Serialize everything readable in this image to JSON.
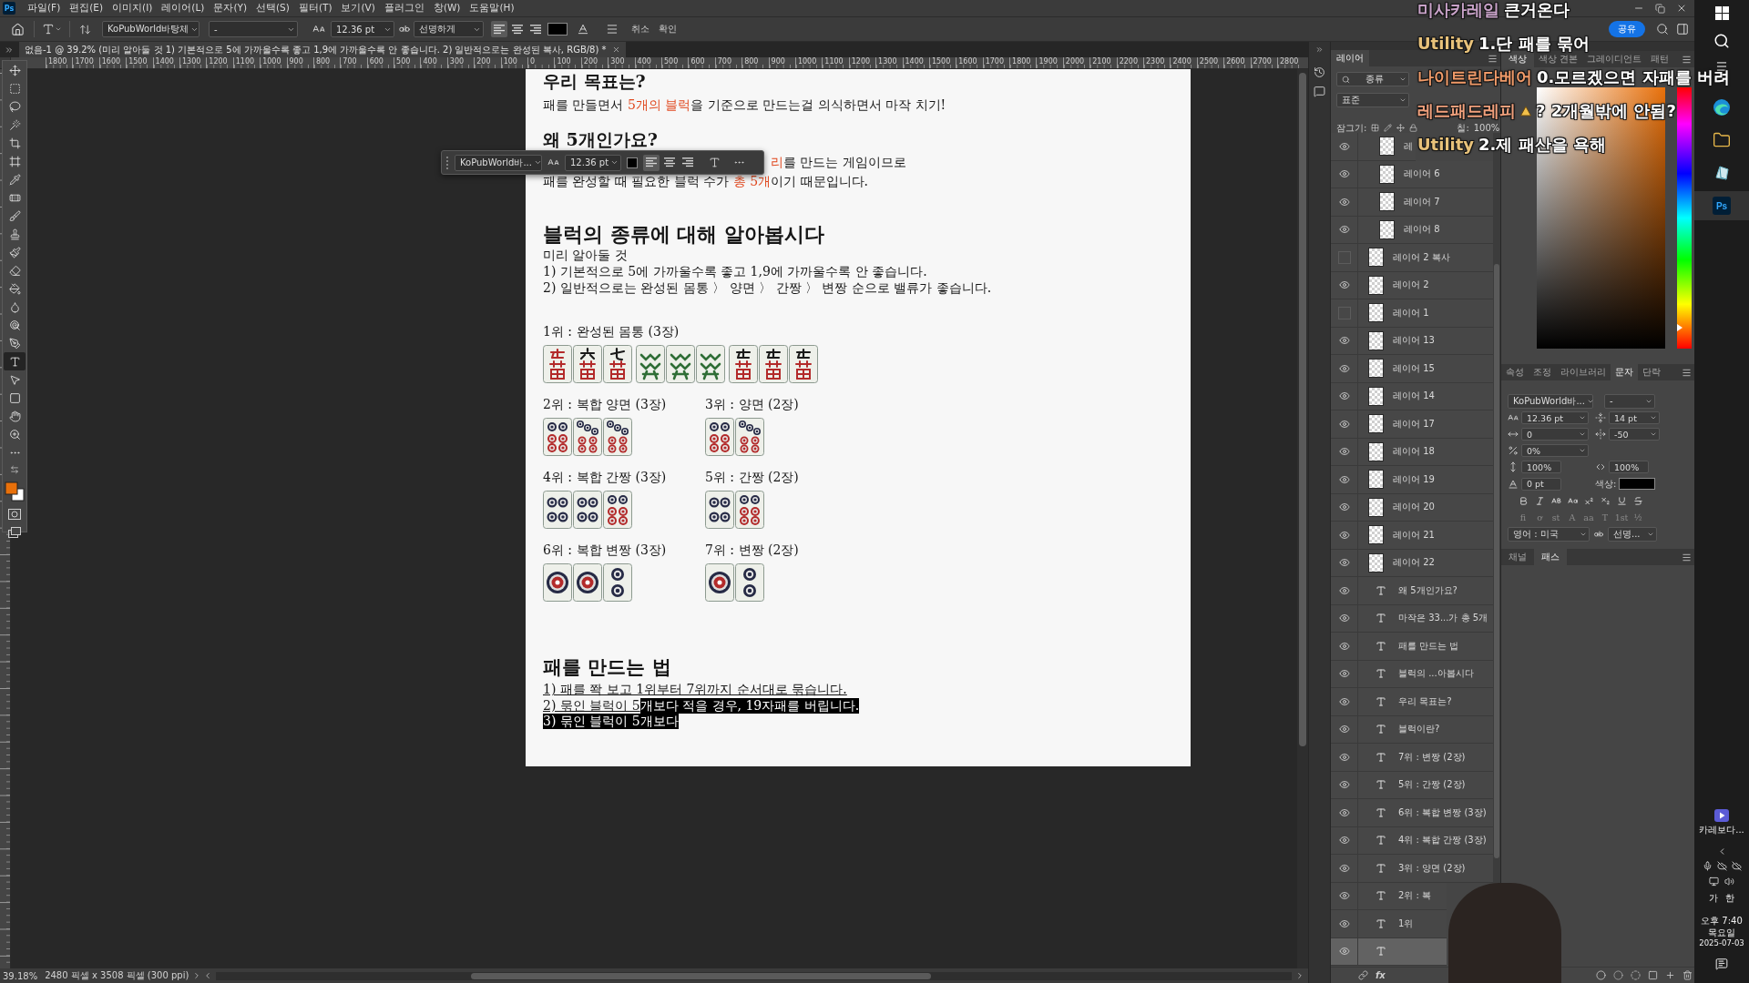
{
  "menu_bar": {
    "logo": "Ps",
    "items": [
      "파일(F)",
      "편집(E)",
      "이미지(I)",
      "레이어(L)",
      "문자(Y)",
      "선택(S)",
      "필터(T)",
      "보기(V)",
      "플러그인",
      "창(W)",
      "도움말(H)"
    ]
  },
  "options_bar": {
    "font": "KoPubWorld바탕체",
    "style": "-",
    "size": "12.36 pt",
    "antialias": "선명하게",
    "align": [
      {
        "kind": "left",
        "selected": true
      },
      {
        "kind": "center",
        "selected": false
      },
      {
        "kind": "right",
        "selected": false
      }
    ],
    "cancel": "취소",
    "commit": "확인",
    "share": "공유"
  },
  "document_tab": {
    "title": "없음-1 @ 39.2% (미리 알아둘 것  1) 기본적으로 5에 가까울수록 좋고 1,9에 가까울수록 안 좋습니다. 2) 일반적으로는 완성된 복사, RGB/8) *"
  },
  "ruler": {
    "labels": [
      "1800",
      "1700",
      "1600",
      "1500",
      "1400",
      "1300",
      "1200",
      "1100",
      "1000",
      "900",
      "800",
      "700",
      "600",
      "500",
      "400",
      "300",
      "200",
      "100",
      "0",
      "100",
      "200",
      "300",
      "400",
      "500",
      "600",
      "700",
      "800",
      "900",
      "1000",
      "1100",
      "1200",
      "1300",
      "1400",
      "1500",
      "1600",
      "1700",
      "1800",
      "1900",
      "2000",
      "2100",
      "2200",
      "2300",
      "2400",
      "2500",
      "2600",
      "2700",
      "2800"
    ]
  },
  "tools": [
    {
      "kind": "move",
      "selected": false
    },
    {
      "kind": "marquee",
      "selected": false
    },
    {
      "kind": "lasso",
      "selected": false
    },
    {
      "kind": "object-select",
      "selected": false
    },
    {
      "kind": "crop",
      "selected": false
    },
    {
      "kind": "frame",
      "selected": false
    },
    {
      "kind": "eyedropper",
      "selected": false
    },
    {
      "kind": "healing",
      "selected": false
    },
    {
      "kind": "brush",
      "selected": false
    },
    {
      "kind": "stamp",
      "selected": false
    },
    {
      "kind": "history-brush",
      "selected": false
    },
    {
      "kind": "eraser",
      "selected": false
    },
    {
      "kind": "bucket",
      "selected": false
    },
    {
      "kind": "blur",
      "selected": false
    },
    {
      "kind": "dodge",
      "selected": false
    },
    {
      "kind": "pen",
      "selected": false
    },
    {
      "kind": "type",
      "selected": true
    },
    {
      "kind": "path-select",
      "selected": false
    },
    {
      "kind": "rectangle",
      "selected": false
    },
    {
      "kind": "hand",
      "selected": false
    },
    {
      "kind": "zoom",
      "selected": false
    },
    {
      "kind": "more",
      "selected": false
    }
  ],
  "context_bar": {
    "font": "KoPubWorld바...",
    "size": "12.36 pt",
    "align": [
      {
        "kind": "left",
        "selected": true
      },
      {
        "kind": "center",
        "selected": false
      },
      {
        "kind": "right",
        "selected": false
      }
    ]
  },
  "document": {
    "goal": {
      "heading": "우리 목표는?",
      "text": "패를 만들면서 **5개의 블럭**을 기준으로 만드는걸 의식하면서 마작 치기!"
    },
    "why": {
      "heading": "왜 5개인가요?",
      "lines": [
        "**리**를 만드는 게임이므로",
        "패를 완성할 때 필요한 블럭 수가 **총 5개**이기 때문입니다."
      ]
    },
    "kinds": {
      "heading": "블럭의 종류에 대해 알아봅시다",
      "notes": [
        "미리 알아둘 것",
        "1) 기본적으로 5에 가까울수록 좋고 1,9에 가까울수록 안 좋습니다.",
        "2) 일반적으로는 완성된 몸통 〉 양면 〉 간짱 〉 변짱 순으로 밸류가 좋습니다."
      ],
      "ranks": [
        {
          "label": "1위 : 완성된 몸통 (3장)",
          "groups": [
            [
              {
                "kind": "man5-red"
              },
              {
                "kind": "man6"
              },
              {
                "kind": "man7"
              }
            ],
            [
              {
                "kind": "dragon"
              },
              {
                "kind": "dragon"
              },
              {
                "kind": "dragon"
              }
            ],
            [
              {
                "kind": "man5"
              },
              {
                "kind": "man5"
              },
              {
                "kind": "man5"
              }
            ]
          ]
        },
        {
          "label": "2위 : 복합 양면 (3장)",
          "groups": [
            [
              {
                "kind": "pin6"
              },
              {
                "kind": "pin7"
              },
              {
                "kind": "pin7"
              }
            ]
          ]
        },
        {
          "label": "3위 : 양면 (2장)",
          "groups": [
            [
              {
                "kind": "pin6"
              },
              {
                "kind": "pin7"
              }
            ]
          ]
        },
        {
          "label": "4위 : 복합 간짱 (3장)",
          "groups": [
            [
              {
                "kind": "pin4"
              },
              {
                "kind": "pin4"
              },
              {
                "kind": "pin6"
              }
            ]
          ]
        },
        {
          "label": "5위 : 간짱 (2장)",
          "groups": [
            [
              {
                "kind": "pin4"
              },
              {
                "kind": "pin6"
              }
            ]
          ]
        },
        {
          "label": "6위 : 복합 변짱 (3장)",
          "groups": [
            [
              {
                "kind": "pin1"
              },
              {
                "kind": "pin1"
              },
              {
                "kind": "pin2"
              }
            ]
          ]
        },
        {
          "label": "7위 : 변짱 (2장)",
          "groups": [
            [
              {
                "kind": "pin1"
              },
              {
                "kind": "pin2"
              }
            ]
          ]
        }
      ]
    },
    "method": {
      "heading": "패를 만드는 법",
      "lines": [
        [
          {
            "text": "1) 패를 쫙 보고 1위부터 7위까지 순서대로 묶습니다.",
            "selected": false
          }
        ],
        [
          {
            "text": "2) 묶인 블럭이 5",
            "selected": false
          },
          {
            "text": "개보다 적을 경우, 19자패를 버립니다.",
            "selected": true
          }
        ],
        [
          {
            "text": "3) 묶인 블럭이 5개보다",
            "selected": true
          }
        ]
      ]
    }
  },
  "status_bar": {
    "zoom": "39.18%",
    "info": "2480 픽셀 x 3508 픽셀 (300 ppi)"
  },
  "layers_panel": {
    "tab": "레이어",
    "search": "종류",
    "blend_mode": "표준",
    "lock_label": "잠그기:",
    "fill_label": "칠:",
    "fill_value": "100%",
    "footer_label": "fx",
    "layers": [
      {
        "kind": "group",
        "children": [
          {
            "kind": "raster",
            "name": "레",
            "visible": true,
            "selected": false
          },
          {
            "kind": "raster",
            "name": "레이어 6",
            "visible": true,
            "selected": false
          },
          {
            "kind": "raster",
            "name": "레이어 7",
            "visible": true,
            "selected": false
          },
          {
            "kind": "raster",
            "name": "레이어 8",
            "visible": true,
            "selected": false
          }
        ]
      },
      {
        "kind": "raster",
        "name": "레이어 2 복사",
        "visible": false,
        "selected": false
      },
      {
        "kind": "raster",
        "name": "레이어 2",
        "visible": true,
        "selected": false
      },
      {
        "kind": "raster",
        "name": "레이어 1",
        "visible": false,
        "selected": false
      },
      {
        "kind": "raster",
        "name": "레이어 13",
        "visible": true,
        "selected": false
      },
      {
        "kind": "raster",
        "name": "레이어 15",
        "visible": true,
        "selected": false
      },
      {
        "kind": "raster",
        "name": "레이어 14",
        "visible": true,
        "selected": false
      },
      {
        "kind": "raster",
        "name": "레이어 17",
        "visible": true,
        "selected": false
      },
      {
        "kind": "raster",
        "name": "레이어 18",
        "visible": true,
        "selected": false
      },
      {
        "kind": "raster",
        "name": "레이어 19",
        "visible": true,
        "selected": false
      },
      {
        "kind": "raster",
        "name": "레이어 20",
        "visible": true,
        "selected": false
      },
      {
        "kind": "raster",
        "name": "레이어 21",
        "visible": true,
        "selected": false
      },
      {
        "kind": "raster",
        "name": "레이어 22",
        "visible": true,
        "selected": false
      },
      {
        "kind": "text",
        "name": "왜 5개인가요?",
        "visible": true,
        "selected": false
      },
      {
        "kind": "text",
        "name": "마작은 33...가 총 5개",
        "visible": true,
        "selected": false
      },
      {
        "kind": "text",
        "name": "패를 만드는 법",
        "visible": true,
        "selected": false
      },
      {
        "kind": "text",
        "name": "블럭의 ...아봅시다",
        "visible": true,
        "selected": false
      },
      {
        "kind": "text",
        "name": "우리 목표는?",
        "visible": true,
        "selected": false
      },
      {
        "kind": "text",
        "name": "블럭이란?",
        "visible": true,
        "selected": false
      },
      {
        "kind": "text",
        "name": "7위 : 변짱 (2장)",
        "visible": true,
        "selected": false
      },
      {
        "kind": "text",
        "name": "5위 : 간짱 (2장)",
        "visible": true,
        "selected": false
      },
      {
        "kind": "text",
        "name": "6위 : 복합 변짱 (3장)",
        "visible": true,
        "selected": false
      },
      {
        "kind": "text",
        "name": "4위 : 복합 간짱 (3장)",
        "visible": true,
        "selected": false
      },
      {
        "kind": "text",
        "name": "3위 : 양면 (2장)",
        "visible": true,
        "selected": false
      },
      {
        "kind": "text",
        "name": "2위 : 복",
        "visible": true,
        "selected": false
      },
      {
        "kind": "text",
        "name": "1위",
        "visible": true,
        "selected": false
      },
      {
        "kind": "text",
        "visible": true,
        "selected": true
      }
    ]
  },
  "color_panel": {
    "tabs": [
      {
        "label": "색상",
        "selected": true
      },
      {
        "label": "색상 견본",
        "selected": false
      },
      {
        "label": "그레이디언트",
        "selected": false
      },
      {
        "label": "패턴",
        "selected": false
      }
    ],
    "hue_slider": {
      "level": 0.08
    }
  },
  "character_panel": {
    "tabs": [
      {
        "label": "속성",
        "selected": false
      },
      {
        "label": "조정",
        "selected": false
      },
      {
        "label": "라이브러리",
        "selected": false
      },
      {
        "label": "문자",
        "selected": true
      },
      {
        "label": "단락",
        "selected": false
      }
    ],
    "font": "KoPubWorld바...",
    "style": "-",
    "size": "12.36 pt",
    "leading": "14 pt",
    "kerning": "0",
    "tracking": "-50",
    "tsume": "0%",
    "vertical_scale": "100%",
    "horizontal_scale": "100%",
    "baseline_shift": "0 pt",
    "color_label": "색상:",
    "styles": [
      {
        "kind": "bold"
      },
      {
        "kind": "italic"
      },
      {
        "kind": "all-caps"
      },
      {
        "kind": "small-caps"
      },
      {
        "kind": "superscript"
      },
      {
        "kind": "subscript"
      },
      {
        "kind": "underline"
      },
      {
        "kind": "strikethrough"
      }
    ],
    "opentype": [
      "fi",
      "ơ",
      "st",
      "A",
      "aa",
      "T",
      "1st",
      "½"
    ],
    "language": "영어 : 미국",
    "antialias": "선명..."
  },
  "paths_panel": {
    "tabs": [
      {
        "label": "채널",
        "selected": false
      },
      {
        "label": "패스",
        "selected": true
      }
    ]
  },
  "chat": [
    {
      "kind": "plain",
      "user": "미사카레일",
      "color": "#c8a2c8",
      "message": "큰거온다"
    },
    {
      "kind": "plain",
      "user": "Utility",
      "color": "#e8c27a",
      "message": "1.단 패를 묶어"
    },
    {
      "kind": "plain",
      "user": "나이트린다베어",
      "color": "#f09a68",
      "message": "0.모르겠으면 자패를 버려"
    },
    {
      "kind": "emoji",
      "user": "레드패드레피",
      "color": "#f0a07c",
      "message": "? 2개월밖에 안됨?"
    },
    {
      "kind": "plain",
      "user": "Utility",
      "color": "#e8c27a",
      "message": "2.제 패산을 욕해"
    }
  ],
  "taskbar": {
    "apps": [
      {
        "kind": "browser",
        "selected": false
      },
      {
        "kind": "folder",
        "selected": false
      },
      {
        "kind": "notes",
        "selected": false
      },
      {
        "kind": "photoshop",
        "label": "Ps",
        "selected": true
      }
    ],
    "media": "카레보다...",
    "ime": [
      "가",
      "한"
    ],
    "time": "오후 7:40",
    "weekday": "목요일",
    "date": "2025-07-03"
  }
}
